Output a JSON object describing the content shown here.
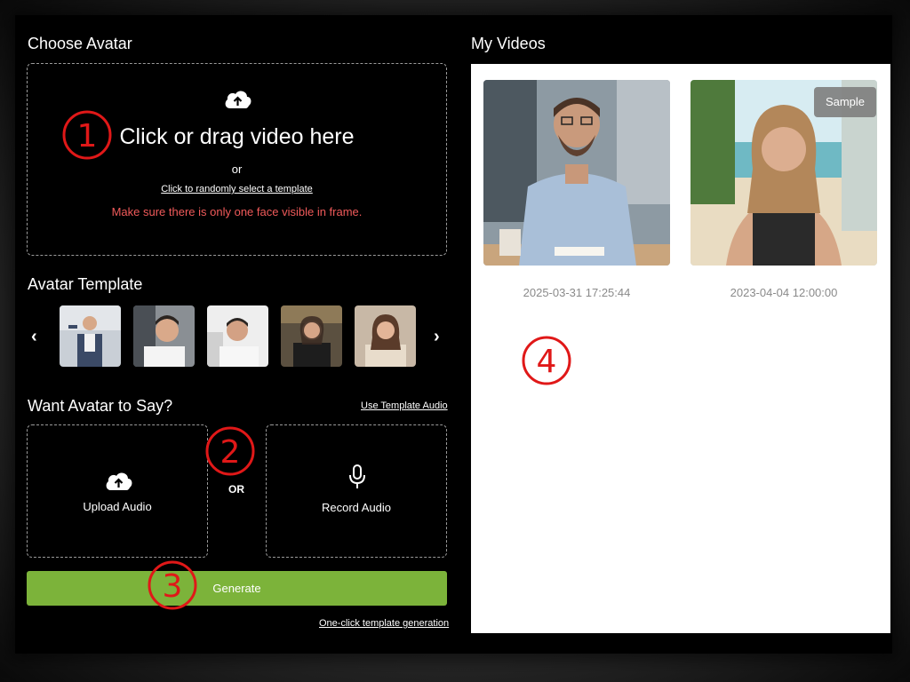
{
  "choose_avatar": {
    "title": "Choose Avatar",
    "upload_main": "Click or drag video here",
    "or": "or",
    "random_link": "Click to randomly select a template",
    "warning": "Make sure there is only one face visible in frame."
  },
  "avatar_template": {
    "title": "Avatar Template",
    "prev": "‹",
    "next": "›"
  },
  "say": {
    "title": "Want Avatar to Say?",
    "template_audio_link": "Use Template Audio",
    "upload_audio": "Upload Audio",
    "or": "OR",
    "record_audio": "Record Audio"
  },
  "generate": {
    "label": "Generate",
    "one_click_link": "One-click template generation"
  },
  "my_videos": {
    "title": "My Videos",
    "videos": [
      {
        "date": "2025-03-31 17:25:44"
      },
      {
        "date": "2023-04-04 12:00:00",
        "badge": "Sample"
      }
    ]
  },
  "markers": [
    "1",
    "2",
    "3",
    "4"
  ],
  "colors": {
    "accent_green": "#7cb33a",
    "warning_red": "#f05a5a",
    "marker_red": "#e01818"
  }
}
